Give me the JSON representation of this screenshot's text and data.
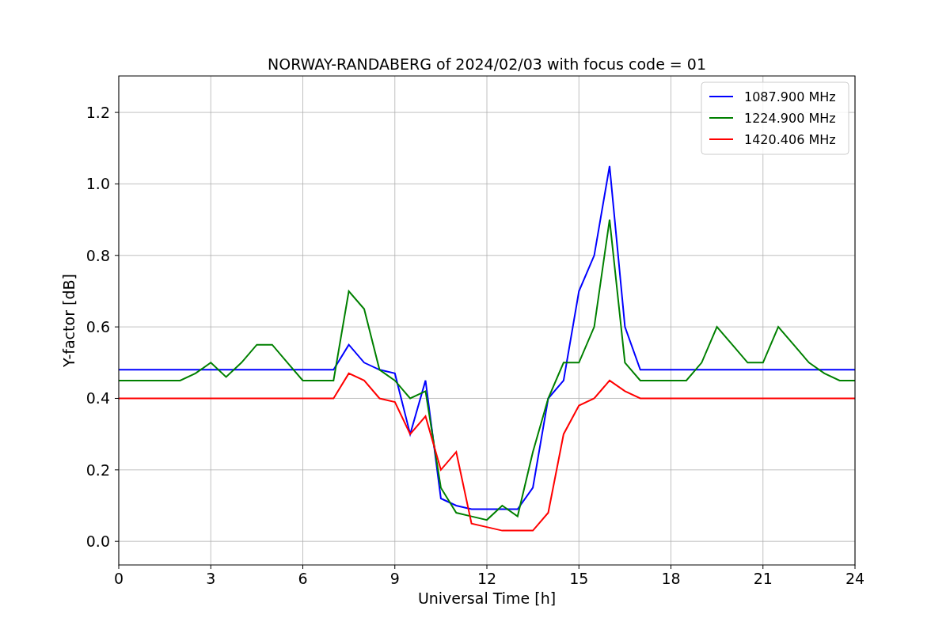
{
  "figure": {
    "chart_data": {
      "type": "line",
      "title": "NORWAY-RANDABERG of 2024/02/03 with focus code = 01",
      "xlabel": "Universal Time [h]",
      "ylabel": "Y-factor [dB]",
      "x": [
        0,
        0.5,
        1,
        1.5,
        2,
        2.5,
        3,
        3.5,
        4,
        4.5,
        5,
        5.5,
        6,
        6.5,
        7,
        7.5,
        8,
        8.5,
        9,
        9.5,
        10,
        10.5,
        11,
        11.5,
        12,
        12.5,
        13,
        13.5,
        14,
        14.5,
        15,
        15.5,
        16,
        16.5,
        17,
        17.5,
        18,
        18.5,
        19,
        19.5,
        20,
        20.5,
        21,
        21.5,
        22,
        22.5,
        23,
        23.5,
        24
      ],
      "series": [
        {
          "name": "1087.900 MHz",
          "color": "#0000ff",
          "values": [
            0.48,
            0.48,
            0.48,
            0.48,
            0.48,
            0.48,
            0.48,
            0.48,
            0.48,
            0.48,
            0.48,
            0.48,
            0.48,
            0.48,
            0.48,
            0.55,
            0.5,
            0.48,
            0.47,
            0.3,
            0.45,
            0.12,
            0.1,
            0.09,
            0.09,
            0.09,
            0.09,
            0.15,
            0.4,
            0.45,
            0.7,
            0.8,
            1.05,
            0.6,
            0.48,
            0.48,
            0.48,
            0.48,
            0.48,
            0.48,
            0.48,
            0.48,
            0.48,
            0.48,
            0.48,
            0.48,
            0.48,
            0.48,
            0.48
          ]
        },
        {
          "name": "1224.900 MHz",
          "color": "#008000",
          "values": [
            0.45,
            0.45,
            0.45,
            0.45,
            0.45,
            0.47,
            0.5,
            0.46,
            0.5,
            0.55,
            0.55,
            0.5,
            0.45,
            0.45,
            0.45,
            0.7,
            0.65,
            0.48,
            0.45,
            0.4,
            0.42,
            0.15,
            0.08,
            0.07,
            0.06,
            0.1,
            0.07,
            0.25,
            0.4,
            0.5,
            0.5,
            0.6,
            0.9,
            0.5,
            0.45,
            0.45,
            0.45,
            0.45,
            0.5,
            0.6,
            0.55,
            0.5,
            0.5,
            0.6,
            0.55,
            0.5,
            0.47,
            0.45,
            0.45
          ]
        },
        {
          "name": "1420.406 MHz",
          "color": "#ff0000",
          "values": [
            0.4,
            0.4,
            0.4,
            0.4,
            0.4,
            0.4,
            0.4,
            0.4,
            0.4,
            0.4,
            0.4,
            0.4,
            0.4,
            0.4,
            0.4,
            0.47,
            0.45,
            0.4,
            0.39,
            0.3,
            0.35,
            0.2,
            0.25,
            0.05,
            0.04,
            0.03,
            0.03,
            0.03,
            0.08,
            0.3,
            0.38,
            0.4,
            0.45,
            0.42,
            0.4,
            0.4,
            0.4,
            0.4,
            0.4,
            0.4,
            0.4,
            0.4,
            0.4,
            0.4,
            0.4,
            0.4,
            0.4,
            0.4,
            0.4
          ]
        }
      ],
      "grid": true,
      "legend": true,
      "xlim": [
        0,
        24
      ],
      "ylim": [
        -0.066,
        1.302
      ],
      "xticks": [
        0,
        3,
        6,
        9,
        12,
        15,
        18,
        21,
        24
      ],
      "yticks": [
        {
          "value": 0,
          "label": "0.0"
        },
        {
          "value": 0.2,
          "label": "0.2"
        },
        {
          "value": 0.4,
          "label": "0.4"
        },
        {
          "value": 0.6,
          "label": "0.6"
        },
        {
          "value": 0.8,
          "label": "0.8"
        },
        {
          "value": 1.0,
          "label": "1.0"
        },
        {
          "value": 1.2,
          "label": "1.2"
        }
      ]
    }
  }
}
